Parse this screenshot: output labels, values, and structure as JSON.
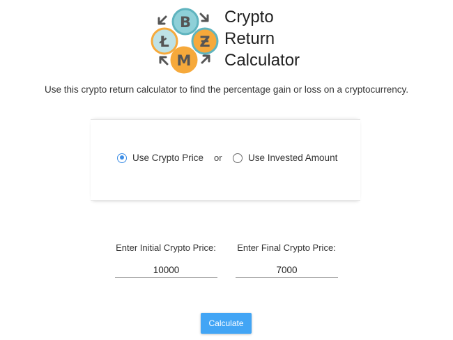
{
  "header": {
    "title_lines": [
      "Crypto",
      "Return",
      "Calculator"
    ],
    "coins": [
      {
        "name": "bitcoin",
        "symbol": "B",
        "color": "#8ed0d8"
      },
      {
        "name": "litecoin",
        "symbol": "Ł",
        "color": "#bfe2e6"
      },
      {
        "name": "zcash",
        "symbol": "Ƶ",
        "color": "#f6a93b"
      },
      {
        "name": "monero",
        "symbol": "M",
        "color": "#f6a93b"
      }
    ]
  },
  "intro_text": "Use this crypto return calculator to find the percentage gain or loss on a cryptocurrency.",
  "mode": {
    "options": [
      "Use Crypto Price",
      "Use Invested Amount"
    ],
    "separator": "or",
    "selected": "Use Crypto Price"
  },
  "inputs": {
    "initial_label": "Enter Initial Crypto Price:",
    "initial_value": "10000",
    "final_label": "Enter Final Crypto Price:",
    "final_value": "7000"
  },
  "calculate_label": "Calculate",
  "colors": {
    "accent": "#42a5f5",
    "radio": "#3d8ee6"
  }
}
